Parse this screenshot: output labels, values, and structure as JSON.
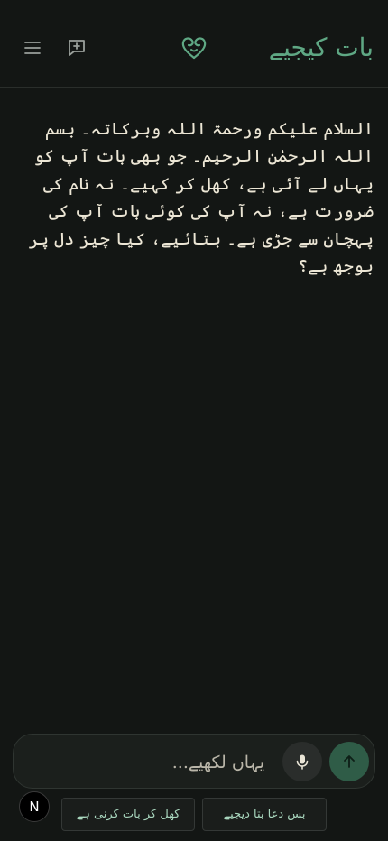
{
  "app": {
    "brand_title": "بات کیجیے"
  },
  "header": {
    "menu_icon": "hamburger-menu-icon",
    "new_chat_icon": "new-chat-icon",
    "logo_icon": "heart-knot-logo-icon"
  },
  "conversation": {
    "assistant_message": "السلام علیکم ورحمۃ اللہ وبرکاتہ۔ بسم اللہ الرحمٰن الرحیم۔ جو بھی بات آپ کو یہاں لے آئی ہے، کھل کر کہیے۔ نہ نام کی ضرورت ہے، نہ آپ کی کوئی بات آپ کی پہچان سے جڑی ہے۔ بتائیے، کیا چیز دل پر بوجھ ہے؟"
  },
  "composer": {
    "placeholder": "یہاں لکھیے...",
    "value": "",
    "mic_icon": "microphone-icon",
    "send_icon": "arrow-up-icon"
  },
  "suggestions": [
    {
      "label": "بس دعا بتا دیجیے"
    },
    {
      "label": "کھل کر بات کرنی ہے"
    }
  ],
  "avatar": {
    "initial": "N"
  },
  "colors": {
    "background": "#131614",
    "accent": "#5fa884",
    "send_button": "#2f5c47",
    "chip_text": "#a8d6bd"
  }
}
